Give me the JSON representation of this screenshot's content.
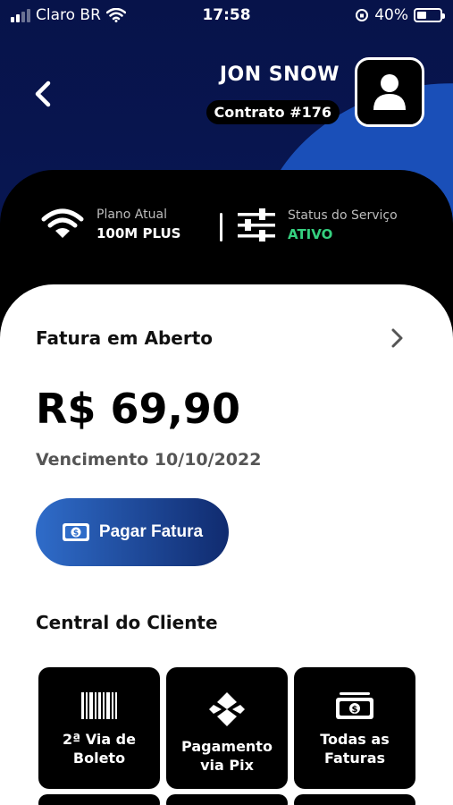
{
  "status_bar": {
    "carrier": "Claro BR",
    "time": "17:58",
    "battery": "40%",
    "battery_level": 0.4
  },
  "header": {
    "user_name": "JON SNOW",
    "contract": "Contrato #176"
  },
  "service": {
    "plan_label": "Plano Atual",
    "plan_value": "100M PLUS",
    "status_label": "Status do Serviço",
    "status_value": "ATIVO"
  },
  "invoice": {
    "title": "Fatura em Aberto",
    "amount": "R$ 69,90",
    "due": "Vencimento 10/10/2022",
    "pay_button": "Pagar Fatura"
  },
  "central": {
    "title": "Central do Cliente",
    "tiles": [
      {
        "label": "2ª Via de\nBoleto",
        "icon": "barcode-icon"
      },
      {
        "label": "Pagamento\nvia Pix",
        "icon": "pix-icon"
      },
      {
        "label": "Todas as\nFaturas",
        "icon": "money-icon"
      }
    ]
  },
  "colors": {
    "accent_blue": "#1a4fb8",
    "status_green": "#35d07f",
    "background_navy": "#07134a"
  }
}
